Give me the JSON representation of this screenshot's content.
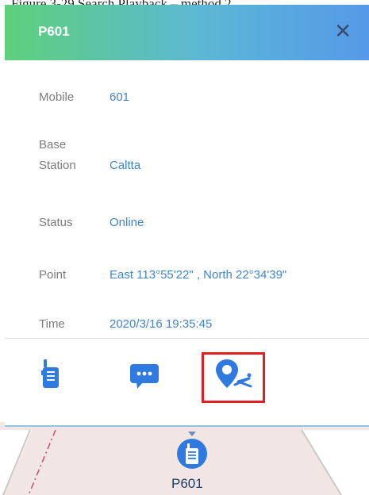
{
  "caption": "Figure 3-29 Search Playback – method 2",
  "popup": {
    "title": "P601",
    "close_glyph": "✕",
    "fields": [
      {
        "label": "Mobile",
        "value": "601"
      },
      {
        "label": "Base Station",
        "label_line1": "Base",
        "label_line2": "Station",
        "value": "Caltta"
      },
      {
        "label": "Status",
        "value": "Online"
      },
      {
        "label": "Point",
        "value": "East 113°55'22\" , North 22°34'39\""
      },
      {
        "label": "Time",
        "value": "2020/3/16 19:35:45"
      }
    ],
    "actions": [
      {
        "icon": "walkie-talkie-icon"
      },
      {
        "icon": "message-icon"
      },
      {
        "icon": "location-track-icon",
        "highlighted": true
      }
    ]
  },
  "map": {
    "marker_label": "P601",
    "marker_icon": "walkie-talkie-icon"
  },
  "colors": {
    "header_start": "#5fd07c",
    "header_end": "#5599e8",
    "value_text": "#3f84d4",
    "icon_blue": "#2f7ae0",
    "highlight_border": "#e02026"
  }
}
